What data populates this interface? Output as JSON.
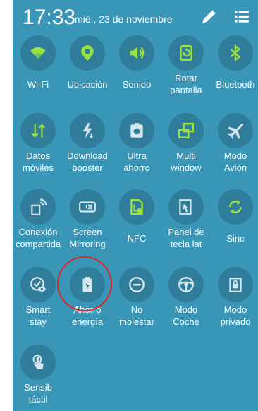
{
  "status_bar": {
    "time": "17:33",
    "date": "mié., 23 de noviembre"
  },
  "colors": {
    "background": "#3a96b6",
    "tile_circle": "#2f7d9a",
    "active_icon": "#9be13f",
    "inactive_icon": "#d5e6ee",
    "highlight": "#e02525"
  },
  "quick_settings": [
    {
      "label": "Wi-Fi",
      "icon": "wifi-icon",
      "active": true
    },
    {
      "label": "Ubicación",
      "icon": "location-icon",
      "active": true
    },
    {
      "label": "Sonido",
      "icon": "sound-icon",
      "active": true
    },
    {
      "label": "Rotar pantalla",
      "icon": "rotate-screen-icon",
      "active": true
    },
    {
      "label": "Bluetooth",
      "icon": "bluetooth-icon",
      "active": true
    },
    {
      "label": "Datos móviles",
      "icon": "mobile-data-icon",
      "active": true
    },
    {
      "label": "Download booster",
      "icon": "download-booster-icon",
      "active": false
    },
    {
      "label": "Ultra ahorro",
      "icon": "ultra-power-saving-icon",
      "active": false
    },
    {
      "label": "Multi window",
      "icon": "multi-window-icon",
      "active": true
    },
    {
      "label": "Modo Avión",
      "icon": "airplane-icon",
      "active": false
    },
    {
      "label": "Conexión compartida",
      "icon": "hotspot-icon",
      "active": false
    },
    {
      "label": "Screen Mirroring",
      "icon": "screen-mirroring-icon",
      "active": false
    },
    {
      "label": "NFC",
      "icon": "nfc-icon",
      "active": true
    },
    {
      "label": "Panel de tecla lat",
      "icon": "side-key-panel-icon",
      "active": false
    },
    {
      "label": "Sinc",
      "icon": "sync-icon",
      "active": true
    },
    {
      "label": "Smart stay",
      "icon": "smart-stay-icon",
      "active": false
    },
    {
      "label": "Ahorro energía",
      "icon": "power-saving-icon",
      "active": false
    },
    {
      "label": "No molestar",
      "icon": "do-not-disturb-icon",
      "active": false
    },
    {
      "label": "Modo Coche",
      "icon": "car-mode-icon",
      "active": false
    },
    {
      "label": "Modo privado",
      "icon": "private-mode-icon",
      "active": false
    },
    {
      "label": "Sensib táctil",
      "icon": "touch-sensitivity-icon",
      "active": false
    }
  ]
}
